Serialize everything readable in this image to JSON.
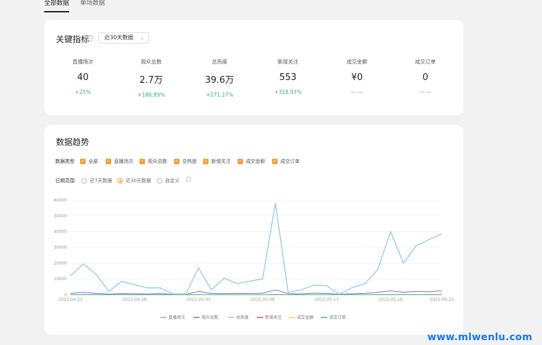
{
  "tabs": [
    {
      "label": "全部数据",
      "active": true
    },
    {
      "label": "单场数据",
      "active": false
    }
  ],
  "key_metrics": {
    "title": "关键指标",
    "help_icon": "question-circle-icon",
    "period_select": "近30天数据",
    "items": [
      {
        "label": "直播场次",
        "value": "40",
        "change": "+25%"
      },
      {
        "label": "观众总数",
        "value": "2.7万",
        "change": "+186.89%"
      },
      {
        "label": "总热度",
        "value": "39.6万",
        "change": "+271.27%"
      },
      {
        "label": "新增关注",
        "value": "553",
        "change": "+318.93%"
      },
      {
        "label": "成交金额",
        "value": "¥0",
        "change": "— —"
      },
      {
        "label": "成交订单",
        "value": "0",
        "change": "— —"
      }
    ]
  },
  "trend": {
    "title": "数据趋势",
    "data_type_label": "数据类型",
    "data_types": [
      "全部",
      "直播场次",
      "观众总数",
      "总热度",
      "新增关注",
      "成交金额",
      "成交订单"
    ],
    "date_range_label": "日期范围",
    "date_options": [
      {
        "label": "近7天数据",
        "selected": false
      },
      {
        "label": "近30天数据",
        "selected": true
      },
      {
        "label": "自定义",
        "selected": false
      }
    ]
  },
  "colors": {
    "accent": "#f0a23a",
    "up": "#3ab26e",
    "watermark": "#1878e8"
  },
  "chart_data": {
    "type": "line",
    "x": [
      "2022-04-23",
      "2022-04-24",
      "2022-04-25",
      "2022-04-26",
      "2022-04-27",
      "2022-04-28",
      "2022-04-29",
      "2022-04-30",
      "2022-05-01",
      "2022-05-02",
      "2022-05-03",
      "2022-05-04",
      "2022-05-05",
      "2022-05-06",
      "2022-05-07",
      "2022-05-08",
      "2022-05-09",
      "2022-05-10",
      "2022-05-11",
      "2022-05-12",
      "2022-05-13",
      "2022-05-14",
      "2022-05-15",
      "2022-05-16",
      "2022-05-17",
      "2022-05-18",
      "2022-05-19",
      "2022-05-20",
      "2022-05-21",
      "2022-05-22"
    ],
    "xticks": [
      "2022-04-23",
      "2022-04-28",
      "2022-05-03",
      "2022-05-08",
      "2022-05-13",
      "2022-05-18",
      "2022-05-22"
    ],
    "ylim": [
      0,
      60000
    ],
    "yticks": [
      0,
      10000,
      20000,
      30000,
      40000,
      50000,
      60000
    ],
    "grid": true,
    "legend_position": "bottom",
    "series": [
      {
        "name": "直播场次",
        "color": "#f08a5d",
        "values": [
          2,
          1,
          2,
          1,
          0,
          2,
          1,
          1,
          2,
          0,
          2,
          1,
          2,
          1,
          2,
          1,
          1,
          2,
          2,
          0,
          2,
          1,
          2,
          1,
          2,
          1,
          2,
          1,
          2,
          1
        ]
      },
      {
        "name": "观众总数",
        "color": "#7b6fd6",
        "values": [
          800,
          1500,
          700,
          300,
          600,
          500,
          400,
          600,
          200,
          100,
          2000,
          700,
          600,
          800,
          700,
          900,
          3000,
          600,
          400,
          900,
          700,
          200,
          500,
          800,
          1500,
          2400,
          1500,
          2100,
          1800,
          2400
        ]
      },
      {
        "name": "总热度",
        "color": "#8ec8ef",
        "values": [
          12000,
          19500,
          13000,
          2000,
          8500,
          6300,
          4300,
          4300,
          500,
          400,
          17000,
          3000,
          10500,
          7000,
          8500,
          10000,
          58000,
          1500,
          3000,
          6000,
          5700,
          200,
          4500,
          7000,
          16000,
          40000,
          20000,
          31000,
          35000,
          38500
        ]
      },
      {
        "name": "新增关注",
        "color": "#e04a6a",
        "values": [
          10,
          30,
          20,
          5,
          15,
          10,
          5,
          10,
          5,
          0,
          40,
          10,
          20,
          10,
          15,
          20,
          80,
          5,
          10,
          15,
          10,
          0,
          10,
          15,
          30,
          60,
          30,
          45,
          50,
          55
        ]
      },
      {
        "name": "成交金额",
        "color": "#f3d15c",
        "values": [
          0,
          0,
          0,
          0,
          0,
          0,
          0,
          0,
          0,
          0,
          0,
          0,
          0,
          0,
          0,
          0,
          0,
          0,
          0,
          0,
          0,
          0,
          0,
          0,
          0,
          0,
          0,
          0,
          0,
          0
        ]
      },
      {
        "name": "成交订单",
        "color": "#3ab26e",
        "values": [
          0,
          0,
          0,
          0,
          0,
          0,
          0,
          0,
          0,
          0,
          0,
          0,
          0,
          0,
          0,
          0,
          0,
          0,
          0,
          0,
          0,
          0,
          0,
          0,
          0,
          0,
          0,
          0,
          0,
          0
        ]
      }
    ]
  },
  "watermark": "www.mlwenlu.com"
}
